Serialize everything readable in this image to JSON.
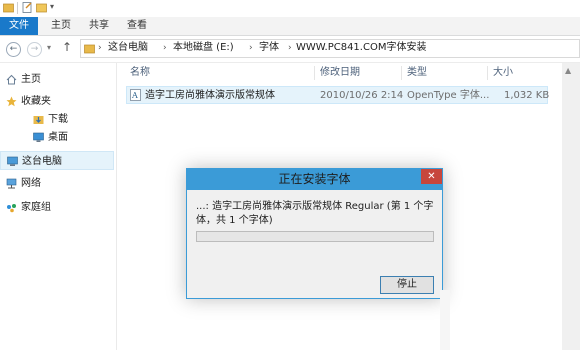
{
  "ribbon": {
    "tabs": [
      {
        "label": "文件",
        "active": true
      },
      {
        "label": "主页",
        "active": false
      },
      {
        "label": "共享",
        "active": false
      },
      {
        "label": "查看",
        "active": false
      }
    ]
  },
  "address": {
    "crumbs": [
      "这台电脑",
      "本地磁盘 (E:)",
      "字体",
      "WWW.PC841.COM字体安装"
    ]
  },
  "navpane": {
    "items": [
      {
        "label": "主页",
        "icon": "home-icon"
      },
      {
        "label": "收藏夹",
        "icon": "star-icon"
      },
      {
        "label": "下载",
        "icon": "download-folder-icon"
      },
      {
        "label": "桌面",
        "icon": "desktop-icon"
      },
      {
        "label": "这台电脑",
        "icon": "computer-icon"
      },
      {
        "label": "网络",
        "icon": "network-icon"
      },
      {
        "label": "家庭组",
        "icon": "homegroup-icon"
      }
    ]
  },
  "filelist": {
    "headers": {
      "name": "名称",
      "date": "修改日期",
      "type": "类型",
      "size": "大小"
    },
    "rows": [
      {
        "name": "造字工房尚雅体演示版常规体",
        "date": "2010/10/26 2:14",
        "type": "OpenType 字体...",
        "size": "1,032 KB"
      }
    ]
  },
  "dialog": {
    "title": "正在安装字体",
    "message": "...: 造字工房尚雅体演示版常规体 Regular (第 1 个字体，共 1 个字体)",
    "progress": 0.0,
    "stop_label": "停止",
    "close_glyph": "✕"
  },
  "colors": {
    "accent": "#1979ca",
    "dialog_title": "#3b9bd7",
    "close_button": "#c7463c",
    "selection": "#e5f3fb"
  }
}
